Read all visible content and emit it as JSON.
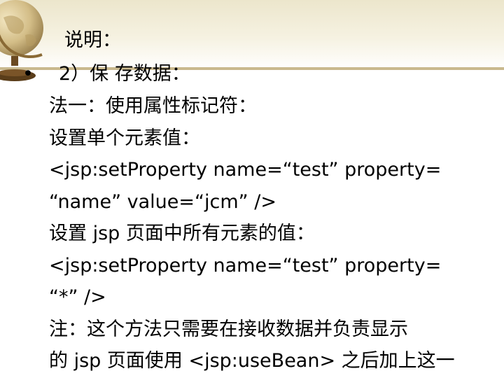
{
  "slide": {
    "title": "说明：",
    "bullet_symbol": "•",
    "bullet_text": "2）保 存数据：",
    "lines": [
      "法一：使用属性标记符：",
      "设置单个元素值：",
      "<jsp:setProperty name=“test” property=",
      "“name” value=“jcm” />",
      "设置 jsp 页面中所有元素的值：",
      "<jsp:setProperty  name=“test” property=",
      "“*” />",
      "注：这个方法只需要在接收数据并负责显示",
      "的 jsp 页面使用 <jsp:useBean> 之后加上这一"
    ]
  },
  "decoration": {
    "icon": "globe-icon",
    "accent_color": "#c9b98e"
  }
}
